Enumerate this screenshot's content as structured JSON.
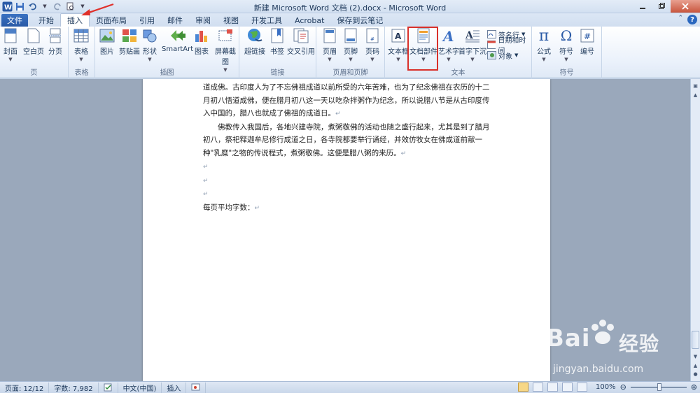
{
  "window": {
    "title": "新建 Microsoft Word 文档 (2).docx  -  Microsoft Word"
  },
  "tabs": [
    {
      "label": "文件"
    },
    {
      "label": "开始"
    },
    {
      "label": "插入"
    },
    {
      "label": "页面布局"
    },
    {
      "label": "引用"
    },
    {
      "label": "邮件"
    },
    {
      "label": "审阅"
    },
    {
      "label": "视图"
    },
    {
      "label": "开发工具"
    },
    {
      "label": "Acrobat"
    },
    {
      "label": "保存到云笔记"
    }
  ],
  "ribbon": {
    "groups": {
      "page": {
        "label": "页",
        "cover": "封面",
        "blank": "空白页",
        "break": "分页"
      },
      "table": {
        "label": "表格",
        "table": "表格"
      },
      "illus": {
        "label": "插图",
        "picture": "图片",
        "clipart": "剪贴画",
        "shapes": "形状",
        "smartart": "SmartArt",
        "chart": "图表",
        "screenshot": "屏幕截图"
      },
      "links": {
        "label": "链接",
        "hyperlink": "超链接",
        "bookmark": "书签",
        "crossref": "交叉引用"
      },
      "headerfooter": {
        "label": "页眉和页脚",
        "header": "页眉",
        "footer": "页脚",
        "pagenum": "页码"
      },
      "text": {
        "label": "文本",
        "textbox": "文本框",
        "quickparts": "文档部件",
        "wordart": "艺术字",
        "dropcap": "首字下沉",
        "signature": "签名行",
        "datetime": "日期和时间",
        "object": "对象"
      },
      "symbols": {
        "label": "符号",
        "equation": "公式",
        "symbol": "符号",
        "number": "编号"
      }
    }
  },
  "document": {
    "p1": "道成佛。古印度人为了不忘佛祖成道以前所受的六年苦难，也为了纪念佛祖在农历的十二月初八悟道成佛，便在腊月初八这一天以吃杂拌粥作为纪念，所以说腊八节是从古印度传入中国的，腊八也就成了佛祖的成道日。",
    "p2": "佛教传入我国后，各地兴建寺院，煮粥敬佛的活动也随之盛行起来，尤其是到了腊月初八，祭祀释迦牟尼修行成道之日，各寺院都要举行诵经，并效仿牧女在佛成道前献一种\"乳糜\"之物的传说程式，煮粥敬佛。这便是腊八粥的来历。",
    "p3": "每页平均字数：",
    "para_mark": "↵"
  },
  "status": {
    "page": "页面: 12/12",
    "words": "字数: 7,982",
    "lang": "中文(中国)",
    "mode": "插入",
    "zoom": "100%"
  },
  "watermark": {
    "main": "Bai",
    "main2": "经验",
    "sub": "jingyan.baidu.com"
  },
  "colors": {
    "accent": "#2a5aa6",
    "highlight": "#d9302a"
  }
}
